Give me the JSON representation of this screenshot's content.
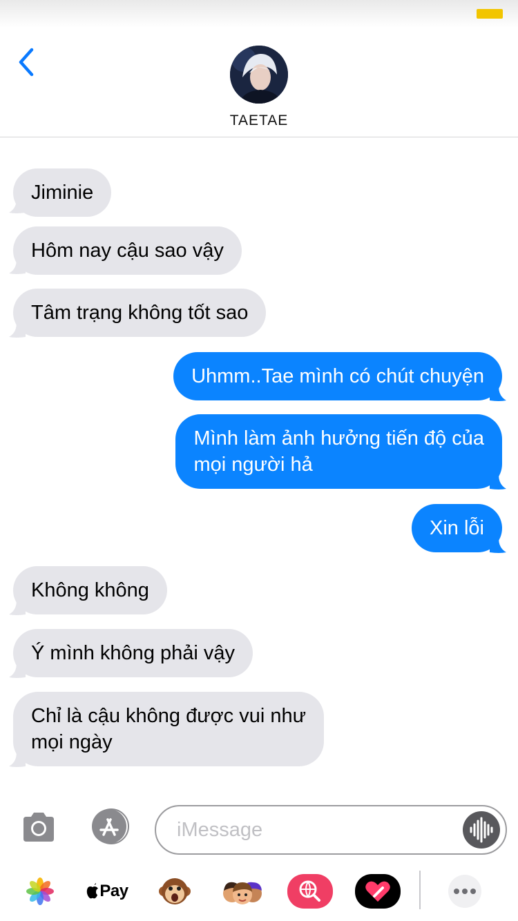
{
  "status_bar": {
    "battery_color": "#f2c500"
  },
  "header": {
    "back_icon": "chevron-left-icon",
    "contact_name": "TAETAE",
    "avatar": "contact-avatar-photo"
  },
  "messages": [
    {
      "from": "contact",
      "text": "Jiminie"
    },
    {
      "from": "contact",
      "text": "Hôm nay cậu sao vậy"
    },
    {
      "from": "contact",
      "text": "Tâm trạng không tốt sao"
    },
    {
      "from": "me",
      "text": "Uhmm..Tae mình có chút chuyện"
    },
    {
      "from": "me",
      "text": "Mình làm ảnh hưởng tiến độ của\nmọi người hả"
    },
    {
      "from": "me",
      "text": "Xin lỗi"
    },
    {
      "from": "contact",
      "text": "Không không"
    },
    {
      "from": "contact",
      "text": "Ý mình không phải vậy"
    },
    {
      "from": "contact",
      "text": "Chỉ là cậu không được vui như\nmọi ngày"
    }
  ],
  "input_bar": {
    "camera_icon": "camera-icon",
    "apps_icon": "app-store-icon",
    "placeholder": "iMessage",
    "audio_icon": "audio-waveform-icon"
  },
  "app_drawer": {
    "items": [
      {
        "name": "photos-app-icon"
      },
      {
        "name": "apple-pay-icon",
        "label": "Pay"
      },
      {
        "name": "animoji-monkey-icon"
      },
      {
        "name": "memoji-stickers-icon"
      },
      {
        "name": "web-images-search-icon"
      },
      {
        "name": "digital-touch-icon"
      },
      {
        "name": "more-apps-icon"
      }
    ]
  },
  "colors": {
    "sent_bubble": "#0b84ff",
    "received_bubble": "#e5e5ea",
    "accent": "#0a7aff"
  }
}
